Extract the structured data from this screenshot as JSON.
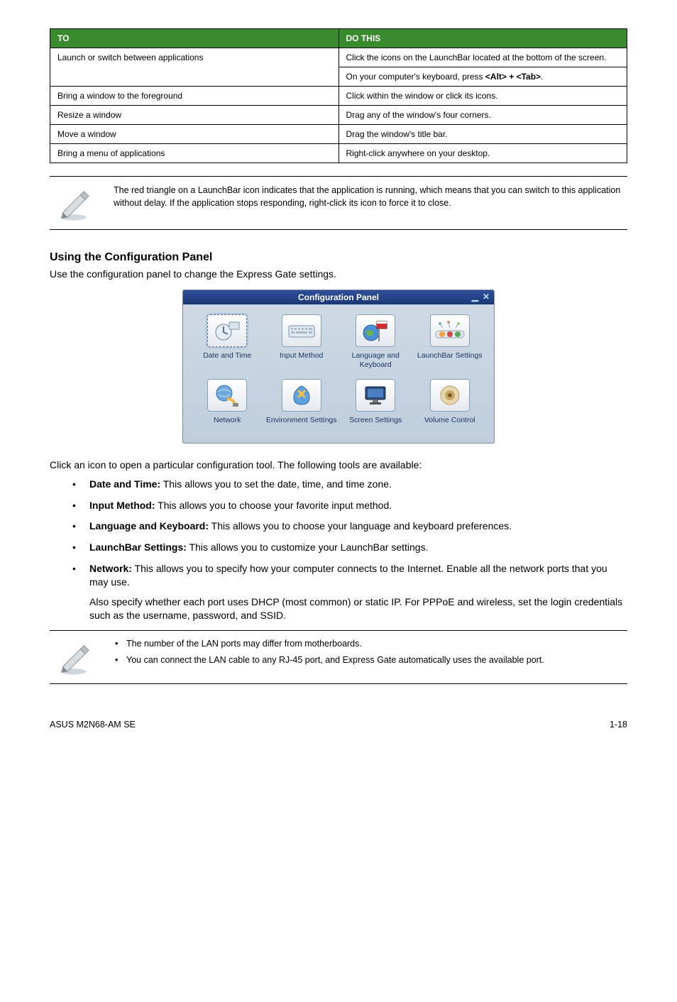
{
  "table": {
    "header": {
      "to": "TO",
      "dothis": "DO THIS"
    },
    "rows": [
      {
        "to": "Launch or switch between applications",
        "do": "Click the icons on the LaunchBar located at the bottom of the screen.",
        "do_extra": "On your computer's keyboard, press <Alt> + <Tab>."
      },
      {
        "to": "Bring a window to the foreground",
        "do": "Click within the window or click its icons."
      },
      {
        "to": "Resize a window",
        "do": "Drag any of the window's four corners."
      },
      {
        "to": "Move a window",
        "do": "Drag the window's title bar."
      },
      {
        "to": "Bring a menu of applications",
        "do": "Right-click anywhere on your desktop."
      }
    ]
  },
  "note1": "The red triangle on a LaunchBar icon indicates that the application is running, which means that you can switch to this application without delay. If the application stops responding, right-click its icon to force it to close.",
  "section_head": "Using the Configuration Panel",
  "section_lead": "Use the configuration panel to change the Express Gate settings.",
  "config_panel": {
    "title": "Configuration Panel",
    "items": [
      {
        "label": "Date and Time"
      },
      {
        "label": "Input Method"
      },
      {
        "label": "Language and Keyboard"
      },
      {
        "label": "LaunchBar Settings"
      },
      {
        "label": "Network"
      },
      {
        "label": "Environment Settings"
      },
      {
        "label": "Screen Settings"
      },
      {
        "label": "Volume Control"
      }
    ]
  },
  "tools_intro": "Click an icon to open a particular configuration tool. The following tools are available:",
  "tools": [
    {
      "bold": "Date and Time:",
      "rest": " This allows you to set the date, time, and time zone."
    },
    {
      "bold": "Input Method:",
      "rest": " This allows you to choose your favorite input method."
    },
    {
      "bold": "Language and Keyboard:",
      "rest": " This allows you to choose your language and keyboard preferences."
    },
    {
      "bold": "LaunchBar Settings:",
      "rest": " This allows you to customize your LaunchBar settings."
    },
    {
      "bold": "Network:",
      "rest": " This allows you to specify how your computer connects to the Internet. Enable all the network ports that you may use.",
      "sub": "Also specify whether each port uses DHCP (most common) or static IP. For PPPoE and wireless, set the login credentials such as the username, password, and SSID."
    }
  ],
  "note2": {
    "items": [
      "The number of the LAN ports may differ from motherboards.",
      "You can connect the LAN cable to any RJ-45 port, and Express Gate automatically uses the available port."
    ]
  },
  "footer": {
    "left": "ASUS M2N68-AM SE",
    "right": "1-18"
  }
}
